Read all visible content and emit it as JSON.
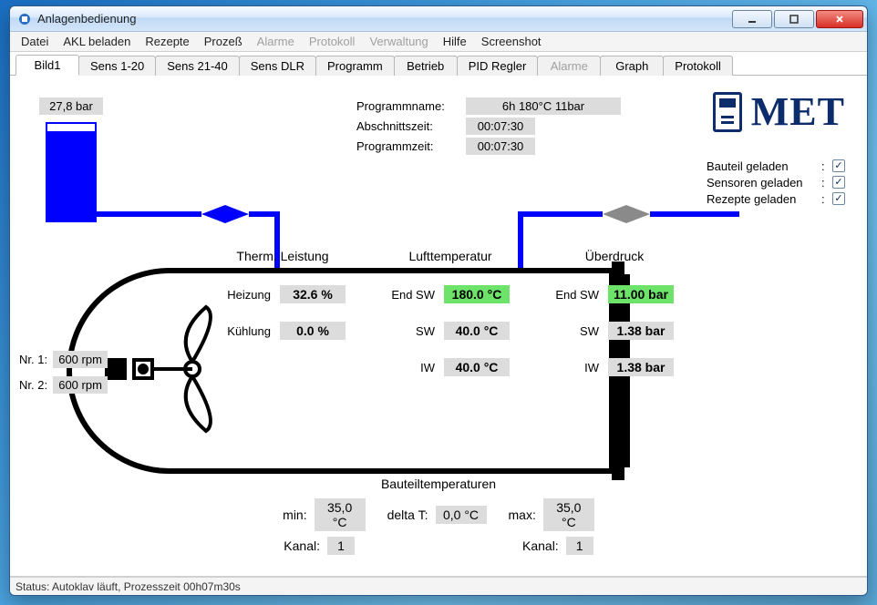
{
  "window": {
    "title": "Anlagenbedienung"
  },
  "menu": [
    {
      "label": "Datei",
      "enabled": true
    },
    {
      "label": "AKL beladen",
      "enabled": true
    },
    {
      "label": "Rezepte",
      "enabled": true
    },
    {
      "label": "Prozeß",
      "enabled": true
    },
    {
      "label": "Alarme",
      "enabled": false
    },
    {
      "label": "Protokoll",
      "enabled": false
    },
    {
      "label": "Verwaltung",
      "enabled": false
    },
    {
      "label": "Hilfe",
      "enabled": true
    },
    {
      "label": "Screenshot",
      "enabled": true
    }
  ],
  "tabs": [
    {
      "label": "Bild1",
      "state": "active"
    },
    {
      "label": "Sens 1-20",
      "state": ""
    },
    {
      "label": "Sens 21-40",
      "state": ""
    },
    {
      "label": "Sens DLR",
      "state": ""
    },
    {
      "label": "Programm",
      "state": ""
    },
    {
      "label": "Betrieb",
      "state": ""
    },
    {
      "label": "PID Regler",
      "state": ""
    },
    {
      "label": "Alarme",
      "state": "disabled"
    },
    {
      "label": "Graph",
      "state": ""
    },
    {
      "label": "Protokoll",
      "state": ""
    }
  ],
  "brand": "MET",
  "status_checks": [
    {
      "label": "Bauteil geladen",
      "checked": true
    },
    {
      "label": "Sensoren geladen",
      "checked": true
    },
    {
      "label": "Rezepte geladen",
      "checked": true
    }
  ],
  "program": {
    "name_label": "Programmname:",
    "name_value": "6h    180°C    11bar",
    "section_label": "Abschnittszeit:",
    "section_value": "00:07:30",
    "prog_label": "Programmzeit:",
    "prog_value": "00:07:30"
  },
  "tank": {
    "pressure": "27,8 bar",
    "fill_percent": 92
  },
  "rpm": [
    {
      "label": "Nr. 1:",
      "value": "600 rpm"
    },
    {
      "label": "Nr. 2:",
      "value": "600 rpm"
    }
  ],
  "therm": {
    "title": "Therm. Leistung",
    "heizung_label": "Heizung",
    "heizung_value": "32.6 %",
    "kuehlung_label": "Kühlung",
    "kuehlung_value": "0.0 %"
  },
  "luft": {
    "title": "Lufttemperatur",
    "end_sw_label": "End SW",
    "end_sw_value": "180.0 °C",
    "sw_label": "SW",
    "sw_value": "40.0 °C",
    "iw_label": "IW",
    "iw_value": "40.0 °C"
  },
  "druck": {
    "title": "Überdruck",
    "end_sw_label": "End SW",
    "end_sw_value": "11.00 bar",
    "sw_label": "SW",
    "sw_value": "1.38 bar",
    "iw_label": "IW",
    "iw_value": "1.38 bar"
  },
  "bauteil": {
    "title": "Bauteiltemperaturen",
    "min_label": "min:",
    "min_value": "35,0 °C",
    "delta_label": "delta T:",
    "delta_value": "0,0 °C",
    "max_label": "max:",
    "max_value": "35,0 °C",
    "kanal_label": "Kanal:",
    "kanal_min": "1",
    "kanal_max": "1"
  },
  "statusbar": "Status: Autoklav läuft, Prozesszeit 00h07m30s"
}
